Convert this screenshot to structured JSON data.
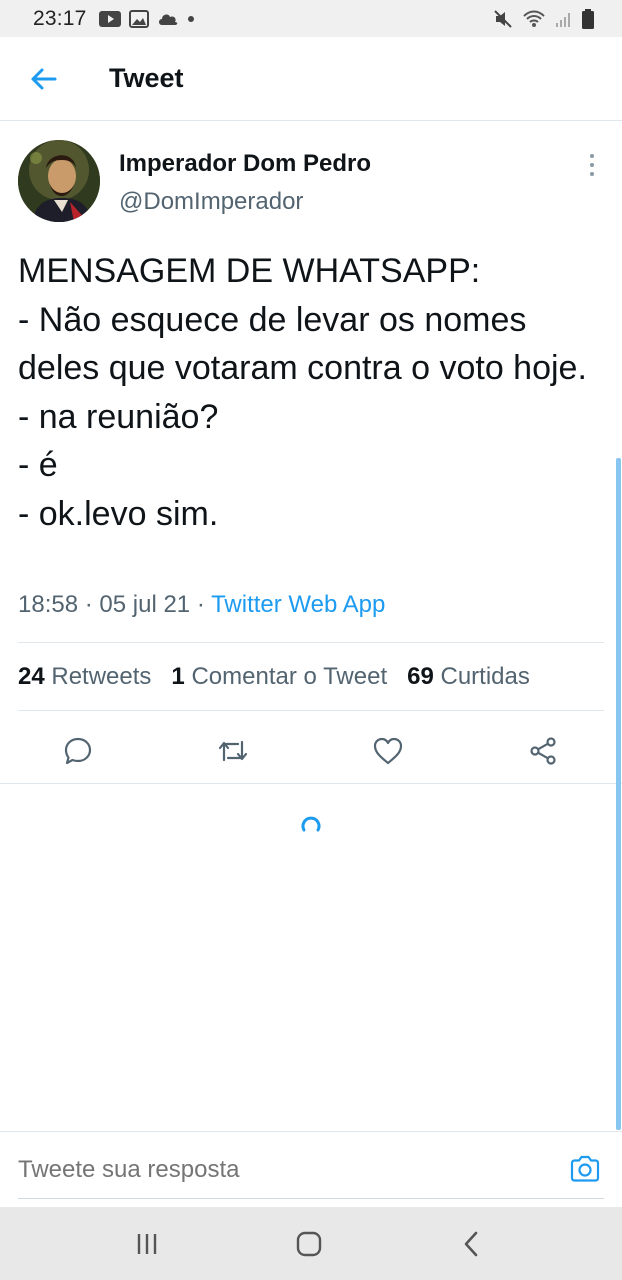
{
  "status_bar": {
    "time": "23:17",
    "left_icons": [
      "youtube-icon",
      "gallery-icon",
      "cloud-icon",
      "dot-icon"
    ],
    "right_icons": [
      "mute-icon",
      "wifi-icon",
      "signal-icon",
      "battery-icon"
    ]
  },
  "app_bar": {
    "title": "Tweet",
    "back_icon": "arrow-left-icon"
  },
  "tweet": {
    "author_name": "Imperador Dom Pedro",
    "author_handle": "@DomImperador",
    "text": "MENSAGEM DE WHATSAPP:\n- Não esquece de levar os nomes deles que votaram contra o voto hoje.\n- na reunião?\n- é\n- ok.levo sim.",
    "time": "18:58",
    "date": "05 jul 21",
    "source": "Twitter Web App",
    "separator": "·"
  },
  "stats": {
    "retweets_count": "24",
    "retweets_label": "Retweets",
    "comments_count": "1",
    "comments_label": "Comentar o Tweet",
    "likes_count": "69",
    "likes_label": "Curtidas"
  },
  "actions": [
    "reply-icon",
    "retweet-icon",
    "like-icon",
    "share-icon"
  ],
  "reply_bar": {
    "placeholder": "Tweete sua resposta",
    "camera_icon": "camera-icon"
  },
  "nav_bar": [
    "recent-apps-icon",
    "home-icon",
    "back-icon"
  ],
  "colors": {
    "accent": "#1d9bf0",
    "text_primary": "#0f1419",
    "text_secondary": "#536471",
    "divider": "#e1e8ed",
    "icon_gray": "#536471"
  }
}
